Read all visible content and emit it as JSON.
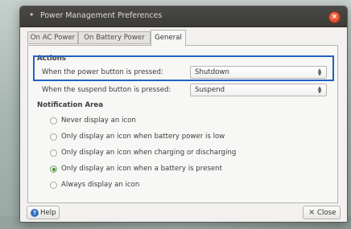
{
  "window": {
    "title": "Power Management Preferences",
    "tabs": [
      {
        "label": "On AC Power"
      },
      {
        "label": "On Battery Power"
      },
      {
        "label": "General"
      }
    ],
    "active_tab": "General"
  },
  "actions": {
    "heading": "Actions",
    "power_button_label": "When the power button is pressed:",
    "power_button_value": "Shutdown",
    "suspend_button_label": "When the suspend button is pressed:",
    "suspend_button_value": "Suspend"
  },
  "notification": {
    "heading": "Notification Area",
    "options": [
      {
        "label": "Never display an icon",
        "selected": false
      },
      {
        "label": "Only display an icon when battery power is low",
        "selected": false
      },
      {
        "label": "Only display an icon when charging or discharging",
        "selected": false
      },
      {
        "label": "Only display an icon when a battery is present",
        "selected": true
      },
      {
        "label": "Always display an icon",
        "selected": false
      }
    ]
  },
  "buttons": {
    "help_label": "Help",
    "close_label": "Close"
  },
  "icons": {
    "window": "window-menu-icon",
    "close": "close-icon",
    "help": "help-icon",
    "dropdown": "up-down-arrows-icon"
  },
  "colors": {
    "highlight": "#1f63c6",
    "titlebar": "#3c3b37",
    "close_orange": "#db4f2b",
    "radio_selected": "#4b8f38"
  }
}
